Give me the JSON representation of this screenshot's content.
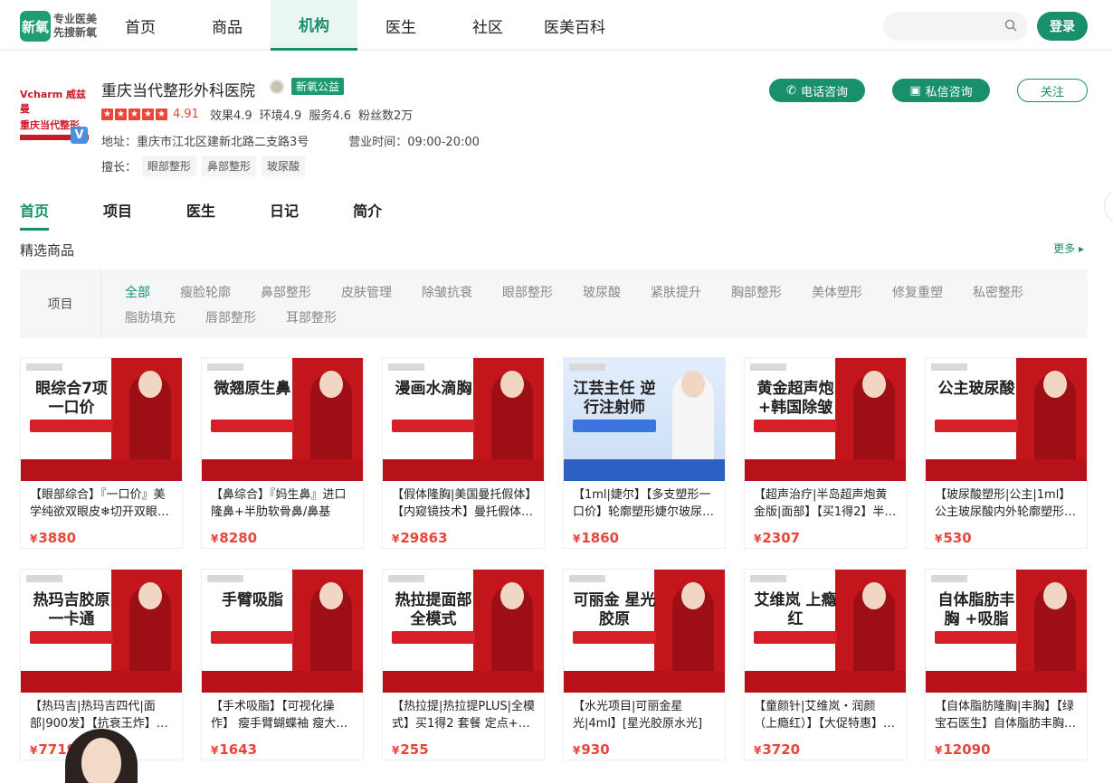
{
  "header": {
    "logo_text": "新氧",
    "slogan_line1": "专业医美",
    "slogan_line2": "先搜新氧",
    "nav": [
      "首页",
      "商品",
      "机构",
      "医生",
      "社区",
      "医美百科"
    ],
    "active_nav": "机构",
    "login_label": "登录"
  },
  "hospital": {
    "logo_line1": "Vcharm 威兹曼",
    "logo_line2": "重庆当代整形",
    "verified_badge": "V",
    "name": "重庆当代整形外科医院",
    "gongyi_label": "新氧公益",
    "stars": 5,
    "score": "4.91",
    "metrics": [
      "效果4.9",
      "环境4.9",
      "服务4.6",
      "粉丝数2万"
    ],
    "address": "地址：重庆市江北区建新北路二支路3号",
    "hours": "营业时间：09:00-20:00",
    "skill_label": "擅长：",
    "skills": [
      "眼部整形",
      "鼻部整形",
      "玻尿酸"
    ],
    "phone_label": "电话咨询",
    "message_label": "私信咨询",
    "follow_label": "关注"
  },
  "tabs": [
    "首页",
    "项目",
    "医生",
    "日记",
    "简介"
  ],
  "active_tab": "首页",
  "section": {
    "title": "精选商品",
    "more": "更多"
  },
  "filter": {
    "label": "项目",
    "items": [
      "全部",
      "瘦脸轮廓",
      "鼻部整形",
      "皮肤管理",
      "除皱抗衰",
      "眼部整形",
      "玻尿酸",
      "紧肤提升",
      "胸部整形",
      "美体塑形",
      "修复重塑",
      "私密整形",
      "脂肪填充",
      "唇部整形",
      "耳部整形"
    ],
    "active": "全部"
  },
  "products": [
    {
      "headline": "眼综合7项 一口价",
      "title": "【眼部综合】『一口价』美学纯欲双眼皮❄切开双眼…",
      "price": "3880",
      "style": "red"
    },
    {
      "headline": "微翘原生鼻",
      "title": "【鼻综合】『妈生鼻』进口隆鼻+半肋软骨鼻/鼻基底…",
      "price": "8280",
      "style": "red"
    },
    {
      "headline": "漫画水滴胸",
      "title": "【假体隆胸|美国曼托假体】【内窥镜技术】曼托假体…",
      "price": "29863",
      "style": "red"
    },
    {
      "headline": "江芸主任 逆行注射师",
      "title": "【1ml|婕尔】【多支塑形一口价】轮廓塑形婕尔玻尿…",
      "price": "1860",
      "style": "blue"
    },
    {
      "headline": "黄金超声炮 +韩国除皱",
      "title": "【超声治疗|半岛超声炮黄金版|面部】【买1得2】半…",
      "price": "2307",
      "style": "red"
    },
    {
      "headline": "公主玻尿酸",
      "title": "【玻尿酸塑形|公主|1ml】公主玻尿酸内外轮廓塑形…",
      "price": "530",
      "style": "red"
    },
    {
      "headline": "热玛吉胶原 一卡通",
      "title": "【热玛吉|热玛吉四代|面部|900发】【抗衰王炸】…",
      "price": "7719",
      "style": "red"
    },
    {
      "headline": "手臂吸脂",
      "title": "【手术吸脂】【可视化操作】 瘦手臂蝴蝶袖 瘦大…",
      "price": "1643",
      "style": "red"
    },
    {
      "headline": "热拉提面部 全模式",
      "title": "【热拉提|热拉提PLUS|全模式】买1得2 套餐 定点+…",
      "price": "255",
      "style": "red"
    },
    {
      "headline": "可丽金 星光胶原",
      "title": "【水光项目|可丽金星光|4ml】[星光胶原水光] …",
      "price": "930",
      "style": "red"
    },
    {
      "headline": "艾维岚 上瘾红",
      "title": "【童颜针|艾维岚・润颜（上瘾红）】【大促特惠】…",
      "price": "3720",
      "style": "red"
    },
    {
      "headline": "自体脂肪丰胸 +吸脂",
      "title": "【自体脂肪隆胸|丰胸】【绿宝石医生】自体脂肪丰胸…",
      "price": "12090",
      "style": "red"
    }
  ],
  "currency": "¥"
}
